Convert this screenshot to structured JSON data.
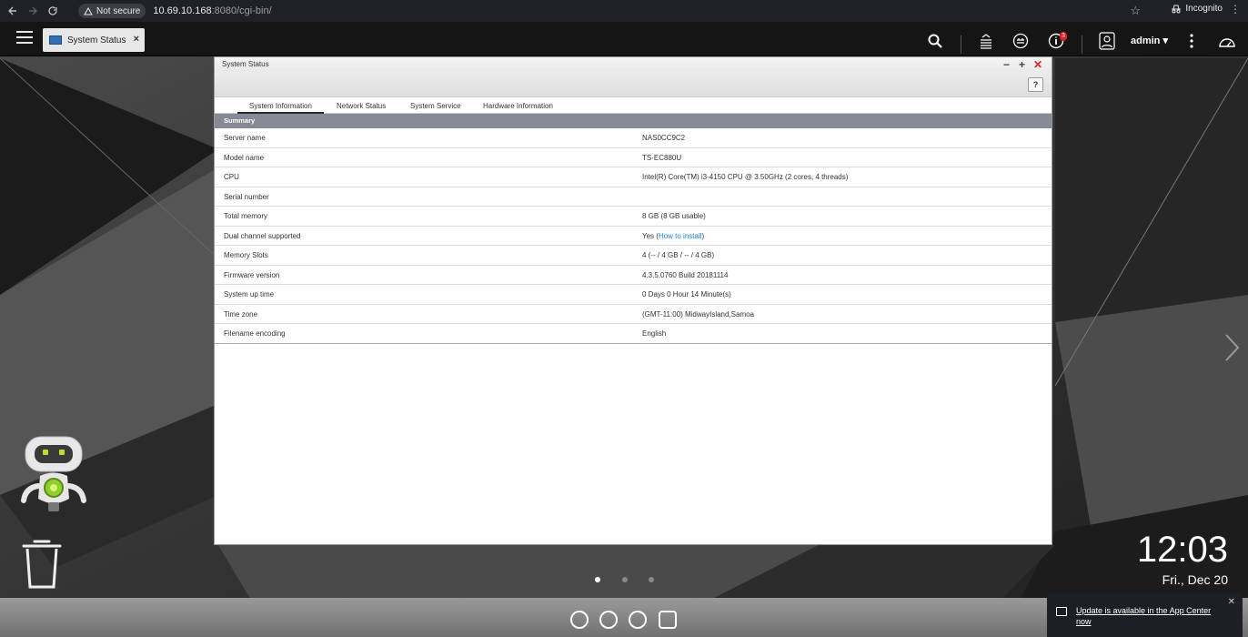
{
  "browser": {
    "security": "Not secure",
    "url_host": "10.69.10.168",
    "url_rest": ":8080/cgi-bin/",
    "mode": "Incognito"
  },
  "topbar": {
    "tab_label": "System Status",
    "notification_count": "3",
    "user": "admin"
  },
  "window": {
    "title": "System Status",
    "help": "?",
    "tabs": [
      "System Information",
      "Network Status",
      "System Service",
      "Hardware Information"
    ],
    "section": "Summary",
    "rows": [
      {
        "label": "Server name",
        "value": "NAS0CC9C2"
      },
      {
        "label": "Model name",
        "value": "TS-EC880U"
      },
      {
        "label": "CPU",
        "value": "Intel(R) Core(TM) i3-4150 CPU @ 3.50GHz (2 cores, 4 threads)"
      },
      {
        "label": "Serial number",
        "value": ""
      },
      {
        "label": "Total memory",
        "value": "8 GB (8 GB usable)"
      },
      {
        "label": "Dual channel supported",
        "value": "Yes (",
        "link": "How to install",
        "suffix": ")"
      },
      {
        "label": "Memory Slots",
        "value": "4 (-- / 4 GB / -- / 4 GB)"
      },
      {
        "label": "Firmware version",
        "value": "4.3.5.0760 Build 20181114"
      },
      {
        "label": "System up time",
        "value": "0 Days 0 Hour 14 Minute(s)"
      },
      {
        "label": "Time zone",
        "value": "(GMT-11:00) MidwayIsland,Samoa"
      },
      {
        "label": "Filename encoding",
        "value": "English"
      }
    ]
  },
  "clock": {
    "time": "12:03",
    "date": "Fri., Dec 20"
  },
  "notification": {
    "text": "Update is available in the App Center now"
  },
  "colors": {
    "accent_link": "#1a7fd1",
    "close_red": "#e02020",
    "summary_bar": "#868a95"
  }
}
